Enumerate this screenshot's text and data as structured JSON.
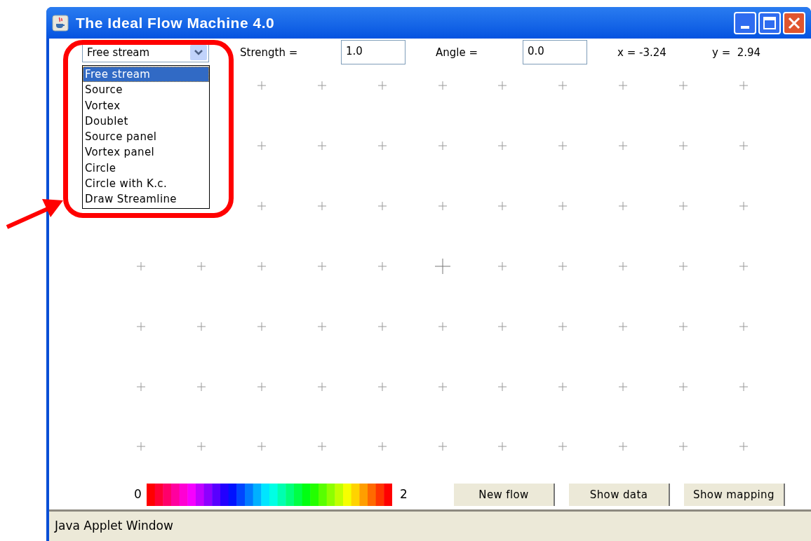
{
  "window": {
    "title": "The Ideal Flow Machine 4.0"
  },
  "element_select": {
    "value": "Free stream",
    "options": [
      {
        "label": "Free stream",
        "selected": true
      },
      {
        "label": "Source",
        "selected": false
      },
      {
        "label": "Vortex",
        "selected": false
      },
      {
        "label": "Doublet",
        "selected": false
      },
      {
        "label": "Source panel",
        "selected": false
      },
      {
        "label": "Vortex panel",
        "selected": false
      },
      {
        "label": "Circle",
        "selected": false
      },
      {
        "label": "Circle with K.c.",
        "selected": false
      },
      {
        "label": "Draw Streamline",
        "selected": false
      }
    ]
  },
  "fields": [
    {
      "label": "Strength =",
      "value": "1.0"
    },
    {
      "label": "Angle =",
      "value": "0.0"
    }
  ],
  "cursor": {
    "x": "x = -3.24",
    "y": "y =  2.94"
  },
  "color_scale": {
    "min": "0",
    "max": "2"
  },
  "buttons": [
    "New flow",
    "Show data",
    "Show mapping"
  ],
  "status_bar": "Java Applet Window"
}
